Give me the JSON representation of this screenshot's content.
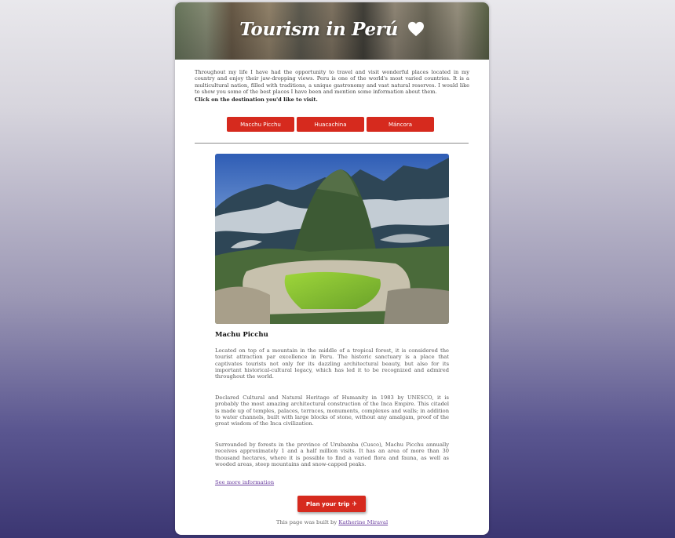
{
  "header": {
    "title": "Tourism in Perú"
  },
  "intro": {
    "text": "Throughout my life I have had the opportunity to travel and visit wonderful places located in my country and enjoy their jaw-dropping views. Peru is one of the world's most varied countries. It is a multicultural nation, filled with traditions, a unique gastronomy and vast natural reserves. I would like to show you some of the best places I have been and mention some information about them.",
    "cta": "Click on the destination you'd like to visit."
  },
  "destinations": [
    {
      "label": "Macchu Picchu"
    },
    {
      "label": "Huacachina"
    },
    {
      "label": "Máncora"
    }
  ],
  "destination": {
    "title": "Machu Picchu",
    "paragraphs": [
      "Located on top of a mountain in the middle of a tropical forest, it is considered the tourist attraction par excellence in Peru. The historic sanctuary is a place that captivates tourists not only for its dazzling architectural beauty, but also for its important historical-cultural legacy, which has led it to be recognized and admired throughout the world.",
      "Declared Cultural and Natural Heritage of Humanity in 1983 by UNESCO, it is probably the most amazing architectural construction of the Inca Empire. This citadel is made up of temples, palaces, terraces, monuments, complexes and walls; in addition to water channels, built with large blocks of stone, without any amalgam, proof of the great wisdom of the Inca civilization.",
      "Surrounded by forests in the province of Urubamba (Cusco), Machu Picchu annually receives approximately 1 and a half million visits. It has an area of more than 30 thousand hectares, where it is possible to find a varied flora and fauna, as well as wooded areas, steep mountains and snow-capped peaks."
    ],
    "more_link": "See more information"
  },
  "plan_button": {
    "label": "Plan your trip",
    "icon": "airplane-icon"
  },
  "footer": {
    "prefix": "This page was built by ",
    "author": "Katherine Miraval"
  },
  "colors": {
    "accent": "#d62a1e",
    "link": "#6b3fa0"
  }
}
